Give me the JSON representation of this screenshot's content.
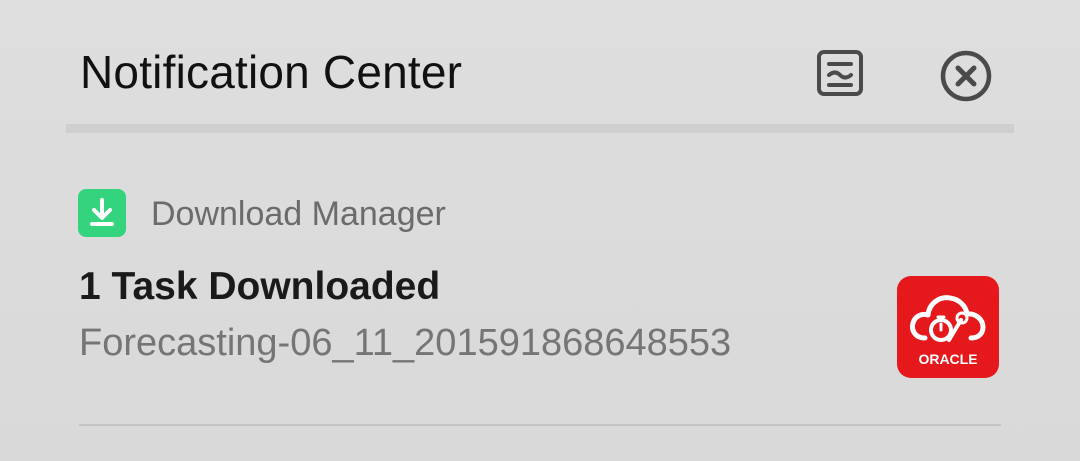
{
  "header": {
    "title": "Notification Center"
  },
  "notification": {
    "app_name": "Download Manager",
    "title": "1 Task Downloaded",
    "body": "Forecasting-06_11_201591868648553",
    "icons": {
      "app": "download-icon",
      "large": "oracle-app-icon"
    },
    "large_icon_label": "ORACLE"
  },
  "colors": {
    "download_green": "#34d47e",
    "oracle_red": "#e5191c"
  }
}
